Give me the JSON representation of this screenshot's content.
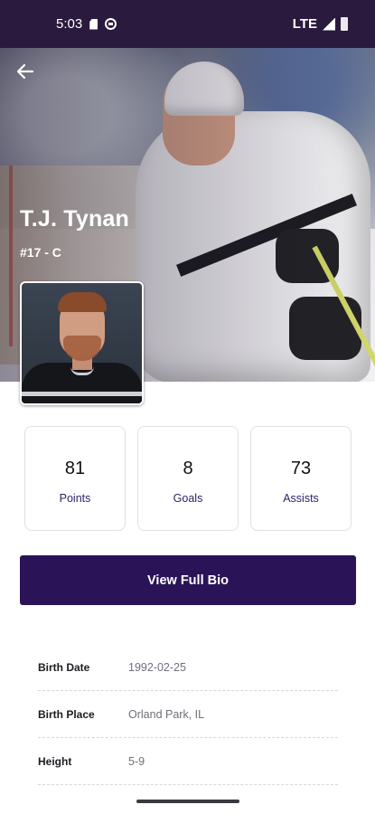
{
  "status_bar": {
    "time": "5:03",
    "network": "LTE"
  },
  "player": {
    "name": "T.J. Tynan",
    "meta": "#17 - C"
  },
  "stats": [
    {
      "value": "81",
      "label": "Points"
    },
    {
      "value": "8",
      "label": "Goals"
    },
    {
      "value": "73",
      "label": "Assists"
    }
  ],
  "actions": {
    "view_bio_label": "View Full Bio"
  },
  "details": [
    {
      "label": "Birth Date",
      "value": "1992-02-25"
    },
    {
      "label": "Birth Place",
      "value": "Orland Park, IL"
    },
    {
      "label": "Height",
      "value": "5-9"
    }
  ],
  "colors": {
    "status_bar": "#2a1a3e",
    "primary_button": "#2a1457",
    "stat_label": "#2f2268"
  },
  "icons": {
    "back": "arrow-left-icon",
    "sim": "sim-card-icon",
    "vpn": "vpn-icon",
    "signal": "signal-icon",
    "battery": "battery-icon"
  }
}
